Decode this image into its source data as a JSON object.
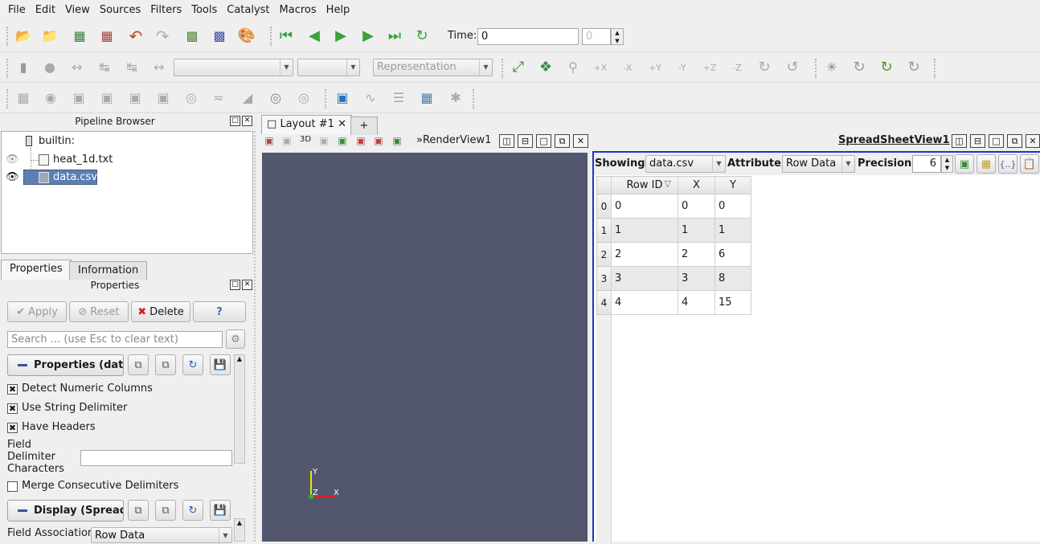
{
  "menu": [
    {
      "label": "File"
    },
    {
      "label": "Edit"
    },
    {
      "label": "View"
    },
    {
      "label": "Sources"
    },
    {
      "label": "Filters"
    },
    {
      "label": "Tools"
    },
    {
      "label": "Catalyst"
    },
    {
      "label": "Macros"
    },
    {
      "label": "Help"
    }
  ],
  "time": {
    "label": "Time:",
    "value": "0",
    "step_value": "0"
  },
  "toolbar2": {
    "representation_placeholder": "Representation"
  },
  "pipeline": {
    "title": "Pipeline Browser",
    "root": "builtin:",
    "items": [
      {
        "label": "heat_1d.txt"
      },
      {
        "label": "data.csv"
      }
    ]
  },
  "tabs": {
    "properties": "Properties",
    "information": "Information"
  },
  "properties": {
    "title": "Properties",
    "apply": "Apply",
    "reset": "Reset",
    "delete": "Delete",
    "help": "?",
    "search_placeholder": "Search ... (use Esc to clear text)",
    "section1": "Properties (data.csv)",
    "detect_numeric": "Detect Numeric Columns",
    "use_string_delim": "Use String Delimiter",
    "have_headers": "Have Headers",
    "field_delim_label": "Field Delimiter Characters",
    "field_delim_l1": "Field",
    "field_delim_l2": "Delimiter",
    "field_delim_l3": "Characters",
    "field_delim_value": "",
    "merge_delims": "Merge Consecutive Delimiters",
    "section2": "Display (SpreadSheetRepresentation)",
    "field_assoc_label": "Field Association",
    "field_assoc_value": "Row Data"
  },
  "layout": {
    "tab_label": "Layout #1",
    "add_tab": "+",
    "render_view": "RenderView1",
    "spread_view": "SpreadSheetView1",
    "three_d": "3D"
  },
  "axes": {
    "y": "Y",
    "z": "Z",
    "x": "X"
  },
  "spreadsheet": {
    "showing_label": "Showing",
    "showing_value": "data.csv",
    "attribute_label": "Attribute:",
    "attribute_value": "Row Data",
    "precision_label": "Precision:",
    "precision_value": "6",
    "columns": [
      "Row ID",
      "X",
      "Y"
    ],
    "rows": [
      {
        "idx": "0",
        "cells": [
          "0",
          "0",
          "0"
        ]
      },
      {
        "idx": "1",
        "cells": [
          "1",
          "1",
          "1"
        ]
      },
      {
        "idx": "2",
        "cells": [
          "2",
          "2",
          "6"
        ]
      },
      {
        "idx": "3",
        "cells": [
          "3",
          "3",
          "8"
        ]
      },
      {
        "idx": "4",
        "cells": [
          "4",
          "4",
          "15"
        ]
      }
    ]
  },
  "colors": {
    "render_bg": "#52576e",
    "selection": "#5b7fb5",
    "focus_border": "#1c36c8"
  }
}
